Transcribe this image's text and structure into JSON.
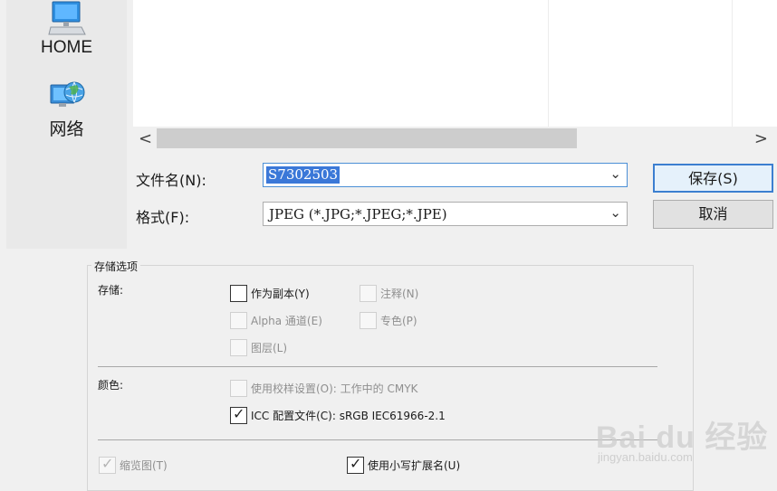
{
  "places": [
    {
      "icon": "home-computer-icon",
      "label": "HOME"
    },
    {
      "icon": "network-globe-icon",
      "label": "网络"
    }
  ],
  "file_name": {
    "label": "文件名(N):",
    "value": "S7302503"
  },
  "format": {
    "label": "格式(F):",
    "value": "JPEG (*.JPG;*.JPEG;*.JPE)"
  },
  "buttons": {
    "save": "保存(S)",
    "cancel": "取消"
  },
  "storage_options": {
    "title": "存储选项",
    "storage_label": "存储:",
    "color_label": "颜色:",
    "options": {
      "as_copy": {
        "label": "作为副本(Y)",
        "checked": false,
        "enabled": true
      },
      "notes": {
        "label": "注释(N)",
        "checked": false,
        "enabled": false
      },
      "alpha": {
        "label": "Alpha 通道(E)",
        "checked": false,
        "enabled": false
      },
      "spot": {
        "label": "专色(P)",
        "checked": false,
        "enabled": false
      },
      "layers": {
        "label": "图层(L)",
        "checked": false,
        "enabled": false
      },
      "proof": {
        "label": "使用校样设置(O):  工作中的 CMYK",
        "checked": false,
        "enabled": false
      },
      "icc": {
        "label": "ICC 配置文件(C):  sRGB IEC61966-2.1",
        "checked": true,
        "enabled": true
      },
      "thumbnail": {
        "label": "缩览图(T)",
        "checked": true,
        "enabled": false
      },
      "lowercase_ext": {
        "label": "使用小写扩展名(U)",
        "checked": true,
        "enabled": true
      }
    }
  },
  "watermark": {
    "brand": "Bai du 经验",
    "url": "jingyan.baidu.com"
  }
}
